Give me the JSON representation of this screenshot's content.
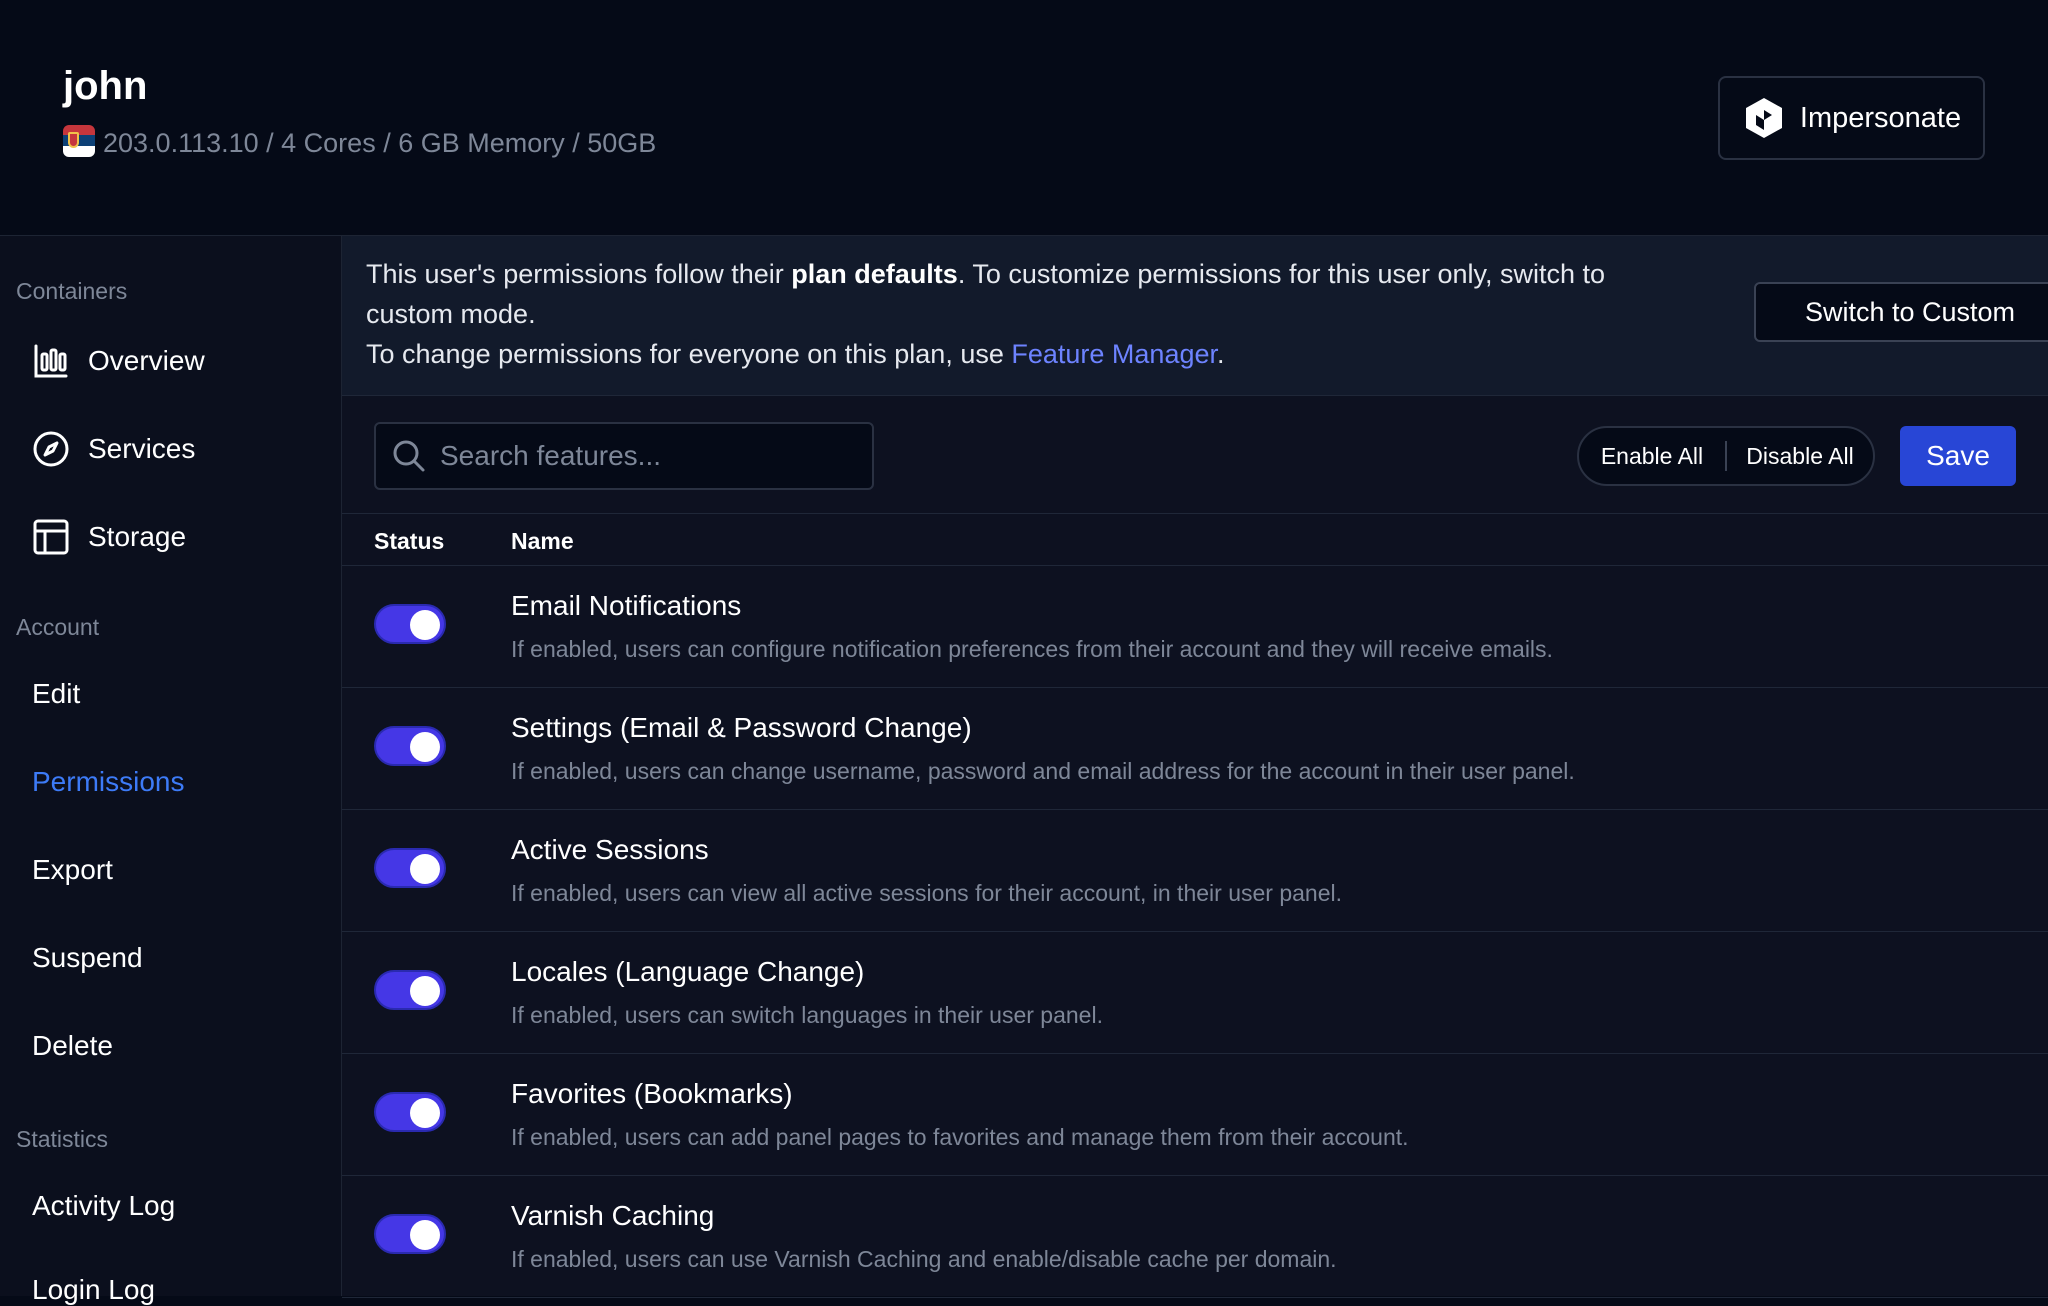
{
  "header": {
    "user_name": "john",
    "server_info": "203.0.113.10 / 4 Cores / 6 GB Memory / 50GB",
    "impersonate_label": "Impersonate"
  },
  "sidebar": {
    "sections": [
      {
        "label": "Containers",
        "items": [
          {
            "label": "Overview",
            "icon": "bar-chart-icon"
          },
          {
            "label": "Services",
            "icon": "compass-icon"
          },
          {
            "label": "Storage",
            "icon": "table-layout-icon"
          }
        ]
      },
      {
        "label": "Account",
        "items": [
          {
            "label": "Edit"
          },
          {
            "label": "Permissions",
            "active": true
          },
          {
            "label": "Export"
          },
          {
            "label": "Suspend"
          },
          {
            "label": "Delete"
          }
        ]
      },
      {
        "label": "Statistics",
        "items": [
          {
            "label": "Activity Log"
          },
          {
            "label": "Login Log"
          }
        ]
      }
    ]
  },
  "notice": {
    "text_before": "This user's permissions follow their ",
    "text_bold": "plan defaults",
    "text_after": ". To customize permissions for this user only, switch to custom mode.",
    "line2_before": "To change permissions for everyone on this plan, use ",
    "line2_link": "Feature Manager",
    "line2_after": ".",
    "switch_label": "Switch to Custom"
  },
  "toolbar": {
    "search_placeholder": "Search features...",
    "enable_all_label": "Enable All",
    "disable_all_label": "Disable All",
    "save_label": "Save"
  },
  "table": {
    "columns": [
      "Status",
      "Name"
    ],
    "rows": [
      {
        "enabled": true,
        "title": "Email Notifications",
        "description": "If enabled, users can configure notification preferences from their account and they will receive emails."
      },
      {
        "enabled": true,
        "title": "Settings (Email & Password Change)",
        "description": "If enabled, users can change username, password and email address for the account in their user panel."
      },
      {
        "enabled": true,
        "title": "Active Sessions",
        "description": "If enabled, users can view all active sessions for their account, in their user panel."
      },
      {
        "enabled": true,
        "title": "Locales (Language Change)",
        "description": "If enabled, users can switch languages in their user panel."
      },
      {
        "enabled": true,
        "title": "Favorites (Bookmarks)",
        "description": "If enabled, users can add panel pages to favorites and manage them from their account."
      },
      {
        "enabled": true,
        "title": "Varnish Caching",
        "description": "If enabled, users can use Varnish Caching and enable/disable cache per domain."
      }
    ]
  },
  "colors": {
    "accent": "#2846d6",
    "toggle_on": "#4537e6",
    "active_nav": "#3d7bf7",
    "link": "#6d83ff"
  }
}
